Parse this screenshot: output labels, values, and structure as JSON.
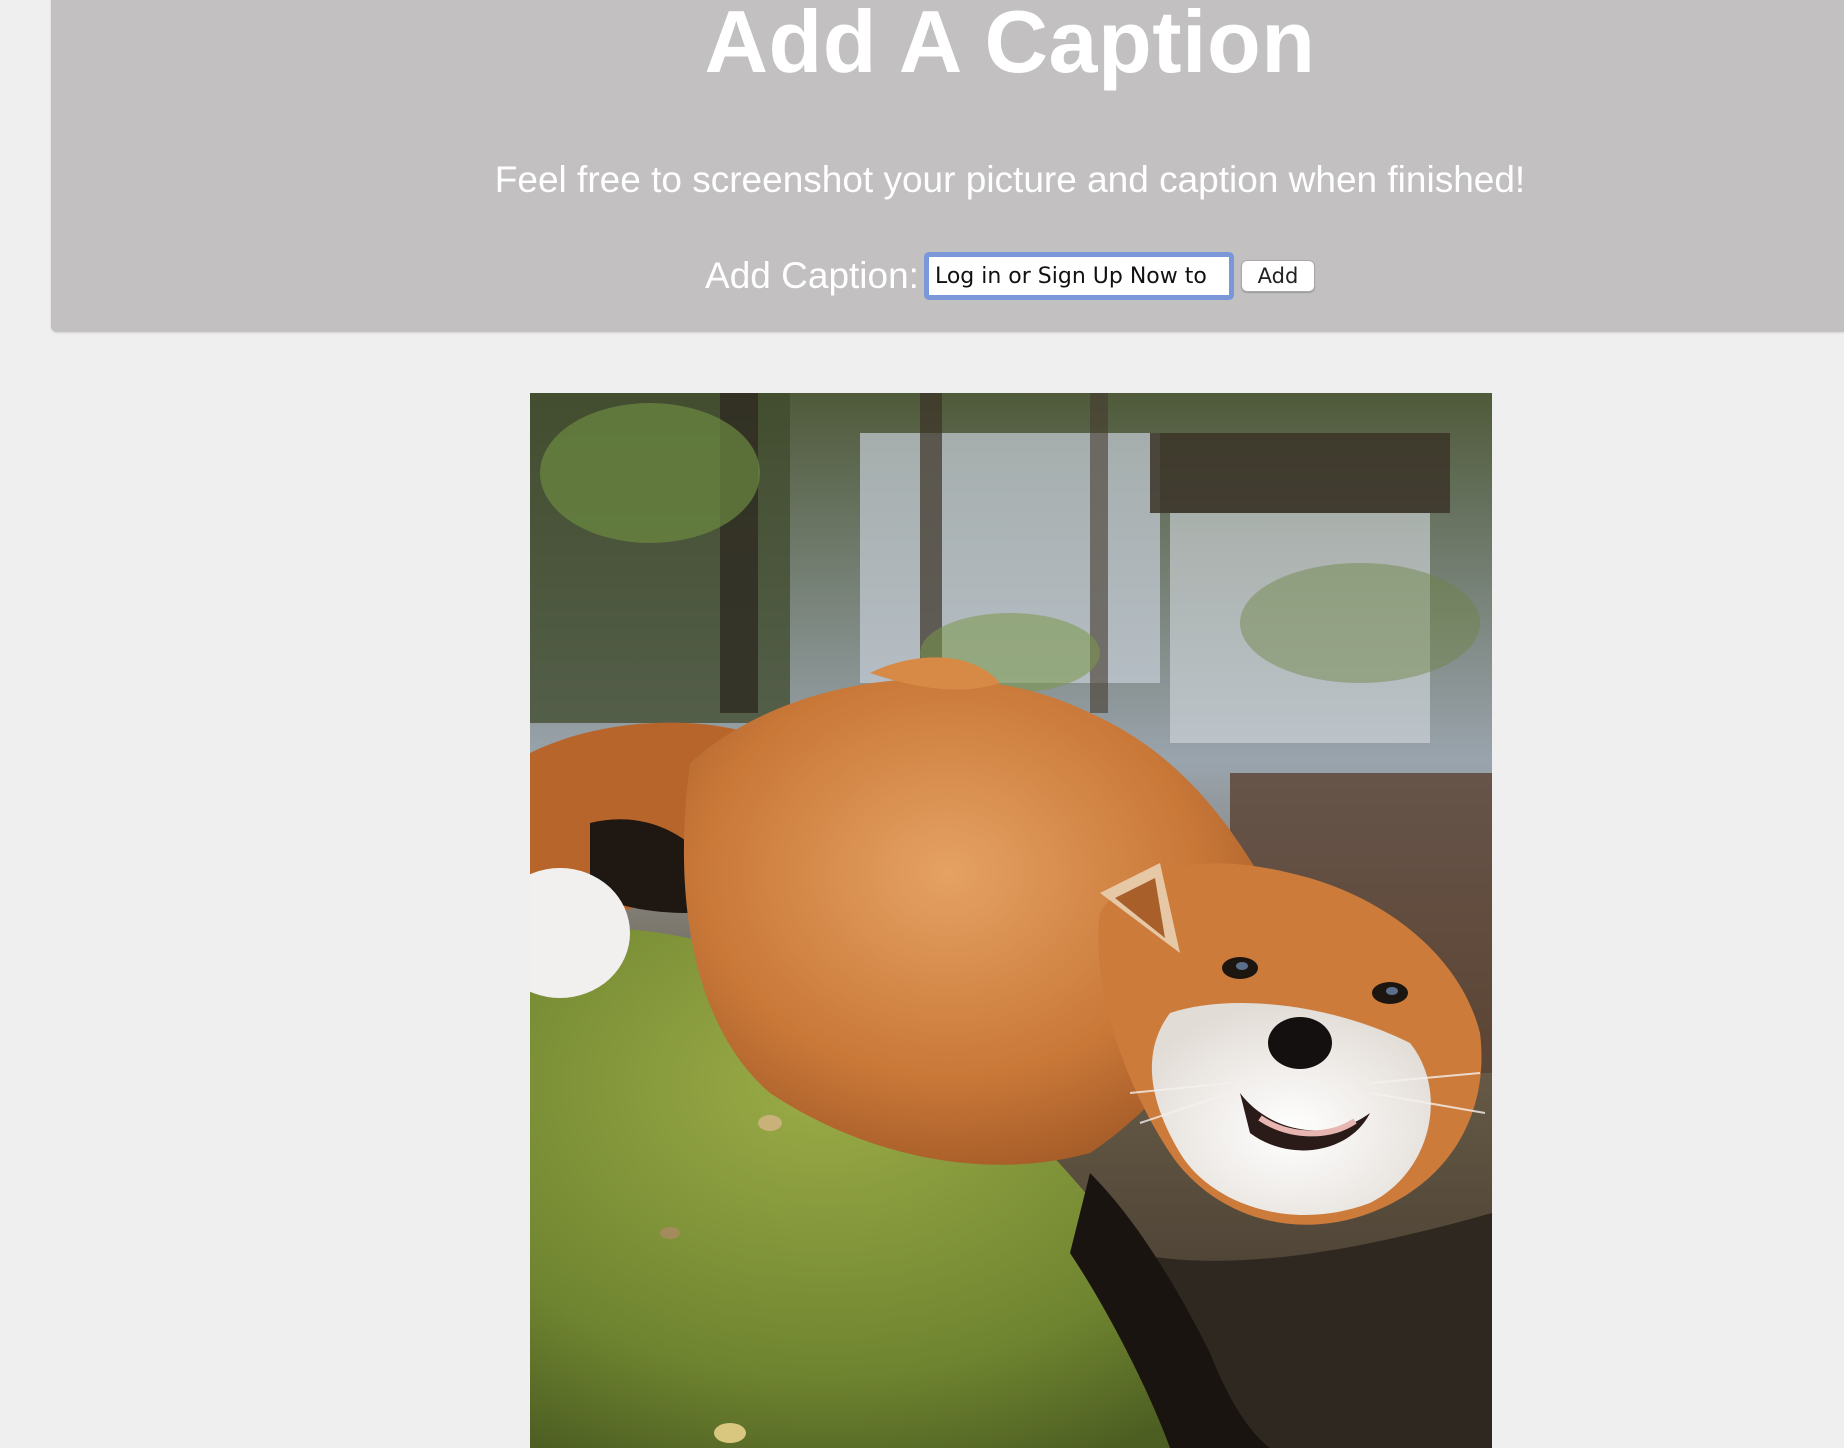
{
  "header": {
    "title": "Add A Caption",
    "subtitle": "Feel free to screenshot your picture and caption when finished!",
    "caption_label": "Add Caption:",
    "caption_value": "Log in or Sign Up Now to",
    "add_button_label": "Add"
  },
  "colors": {
    "page_background": "#efefef",
    "header_background": "#c2c0c1",
    "header_text": "#ffffff",
    "input_focus_border": "#7a97d8"
  },
  "photo": {
    "subject": "red fox lying on moss"
  }
}
